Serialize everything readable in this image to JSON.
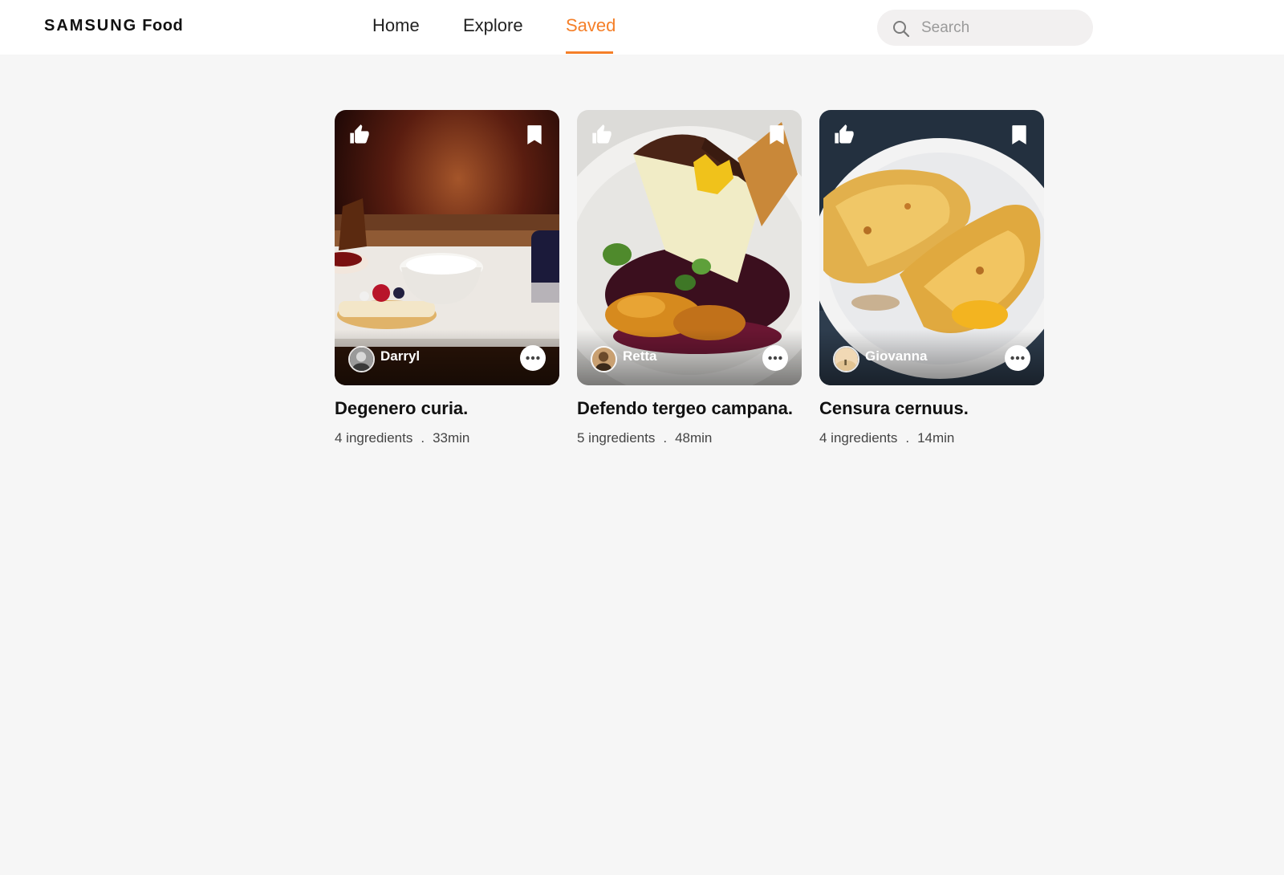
{
  "header": {
    "logo_brand": "SAMSUNG",
    "logo_product": "Food",
    "nav": [
      {
        "label": "Home",
        "active": false
      },
      {
        "label": "Explore",
        "active": false
      },
      {
        "label": "Saved",
        "active": true
      }
    ],
    "search": {
      "placeholder": "Search",
      "value": ""
    }
  },
  "colors": {
    "accent": "#f57f28",
    "page_background": "#f6f6f6",
    "header_background": "#ffffff"
  },
  "recipes": [
    {
      "author": "Darryl",
      "title": "Degenero curia.",
      "ingredients": "4 ingredients",
      "separator": ".",
      "time": "33min",
      "icons": [
        "thumbs-up-icon",
        "bookmark-icon",
        "more-icon"
      ]
    },
    {
      "author": "Retta",
      "title": "Defendo tergeo campana.",
      "ingredients": "5 ingredients",
      "separator": ".",
      "time": "48min",
      "icons": [
        "thumbs-up-icon",
        "bookmark-icon",
        "more-icon"
      ]
    },
    {
      "author": "Giovanna",
      "title": "Censura cernuus.",
      "ingredients": "4 ingredients",
      "separator": ".",
      "time": "14min",
      "icons": [
        "thumbs-up-icon",
        "bookmark-icon",
        "more-icon"
      ]
    }
  ]
}
